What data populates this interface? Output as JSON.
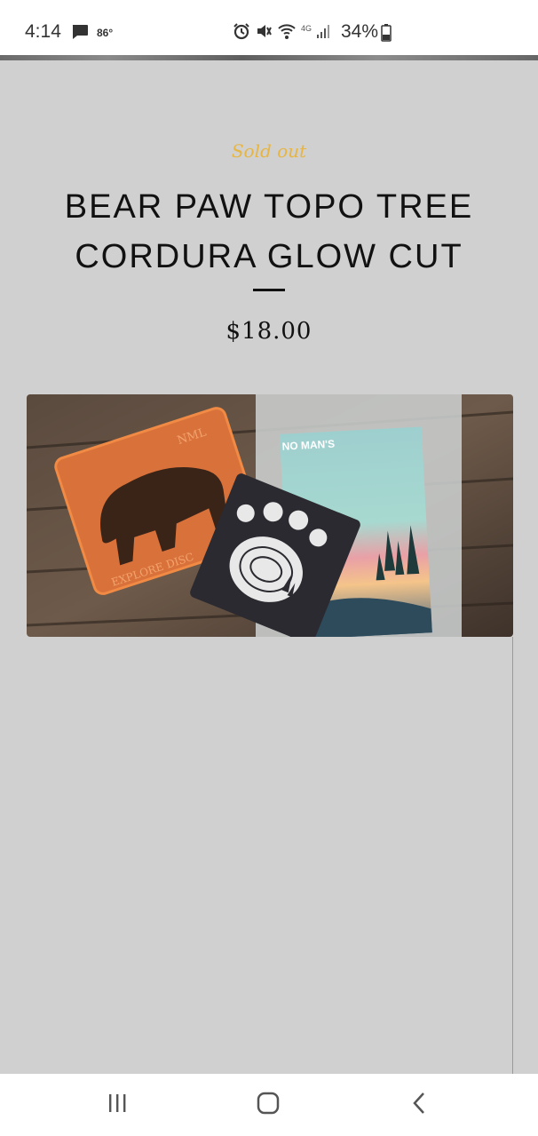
{
  "status_bar": {
    "time": "4:14",
    "temperature": "86°",
    "battery": "34%",
    "icons": [
      "message-icon",
      "alarm-icon",
      "mute-icon",
      "wifi-calling-icon",
      "lte-icon",
      "signal-icon",
      "battery-icon"
    ],
    "network": "4G"
  },
  "product": {
    "badge": "Sold out",
    "title": "BEAR PAW TOPO TREE CORDURA GLOW CUT",
    "price": "$18.00",
    "image_alt": "Bear paw topo tree patch photo",
    "image_text_card": "NO MAN'S",
    "image_text_patch_top": "NML",
    "image_text_patch_bottom": "EXPLORE DISC"
  },
  "nav": {
    "recent": "recent-apps-icon",
    "home": "home-icon",
    "back": "back-icon"
  },
  "colors": {
    "background": "#d0d0d0",
    "sold_out": "#e7b540",
    "text": "#111111"
  }
}
